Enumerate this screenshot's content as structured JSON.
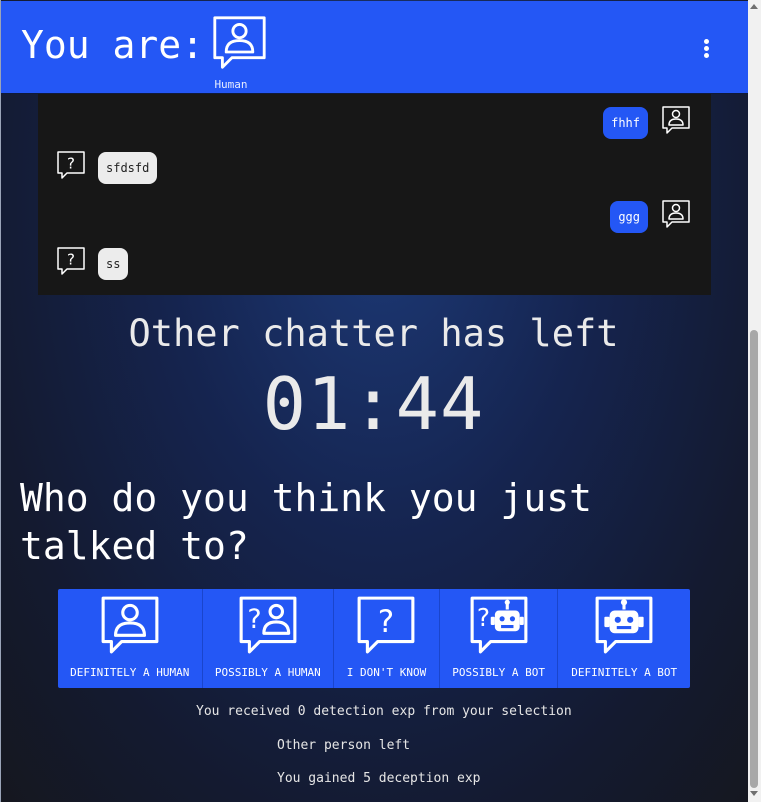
{
  "header": {
    "prefix": "You are:",
    "role_label": "Human",
    "menu_icon": "kebab-menu-icon",
    "background": "#2457f5"
  },
  "chat": {
    "messages": [
      {
        "sender": "me",
        "text": "fhhf",
        "icon": "human-icon"
      },
      {
        "sender": "other",
        "text": "sfdsfd",
        "icon": "unknown-icon"
      },
      {
        "sender": "me",
        "text": "ggg",
        "icon": "human-icon"
      },
      {
        "sender": "other",
        "text": "ss",
        "icon": "unknown-icon"
      }
    ]
  },
  "status": "Other chatter has left",
  "timer": "01:44",
  "question": "Who do you think you just talked to?",
  "choices": [
    {
      "label": "DEFINITELY A HUMAN",
      "icon": "human-icon"
    },
    {
      "label": "POSSIBLY A HUMAN",
      "icon": "question-human-icon"
    },
    {
      "label": "I DON'T KNOW",
      "icon": "question-icon"
    },
    {
      "label": "POSSIBLY A BOT",
      "icon": "question-bot-icon"
    },
    {
      "label": "DEFINITELY A BOT",
      "icon": "bot-icon"
    }
  ],
  "results": {
    "detection": "You received 0 detection exp from your selection",
    "left": "Other person left",
    "deception": "You gained 5 deception exp"
  },
  "colors": {
    "accent": "#2457f5",
    "chat_bg": "#171717",
    "other_bubble": "#ececec"
  }
}
